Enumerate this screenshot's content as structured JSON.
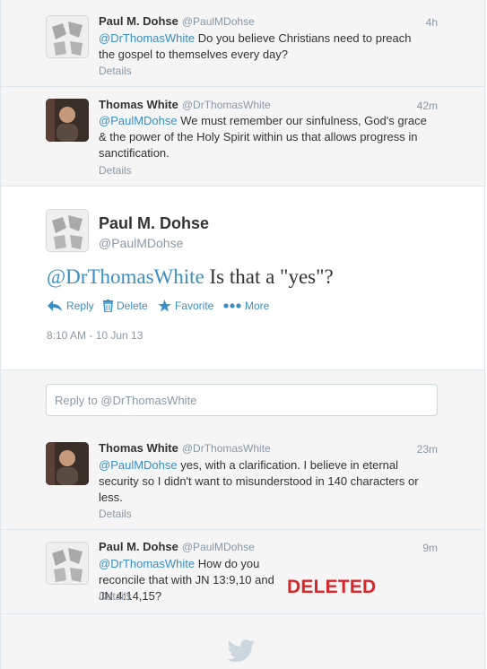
{
  "tweets_before": [
    {
      "name": "Paul M. Dohse",
      "handle": "@PaulMDohse",
      "time": "4h",
      "mention": "@DrThomasWhite",
      "text": "  Do you believe Christians need to preach the gospel to themselves every day?",
      "details": "Details"
    },
    {
      "name": "Thomas White",
      "handle": "@DrThomasWhite",
      "time": "42m",
      "mention": "@PaulMDohse",
      "text": " We must remember our sinfulness, God's grace & the power of the Holy Spirit within us that allows progress in sanctification.",
      "details": "Details"
    }
  ],
  "focused": {
    "name": "Paul M. Dohse",
    "handle": "@PaulMDohse",
    "mention": "@DrThomasWhite",
    "text": " Is that a \"yes\"?",
    "actions": {
      "reply": "Reply",
      "delete": "Delete",
      "favorite": "Favorite",
      "more": "More"
    },
    "timestamp": "8:10 AM - 10 Jun 13"
  },
  "reply_box": {
    "placeholder": "Reply to @DrThomasWhite"
  },
  "tweets_after": [
    {
      "name": "Thomas White",
      "handle": "@DrThomasWhite",
      "time": "23m",
      "mention": "@PaulMDohse",
      "text": " yes, with a clarification. I believe in eternal security so I didn't want to misunderstood in 140 characters or less.",
      "details": "Details"
    },
    {
      "name": "Paul M. Dohse",
      "handle": "@PaulMDohse",
      "time": "9m",
      "mention": "@DrThomasWhite",
      "text": " How do you reconcile that with JN 13:9,10 and JN 4:14,15?",
      "details": "Details"
    }
  ],
  "overlay_stamp": "DELETED",
  "colors": {
    "link": "#3b8fc4",
    "muted": "#8899a6",
    "stamp": "#d9262a"
  }
}
